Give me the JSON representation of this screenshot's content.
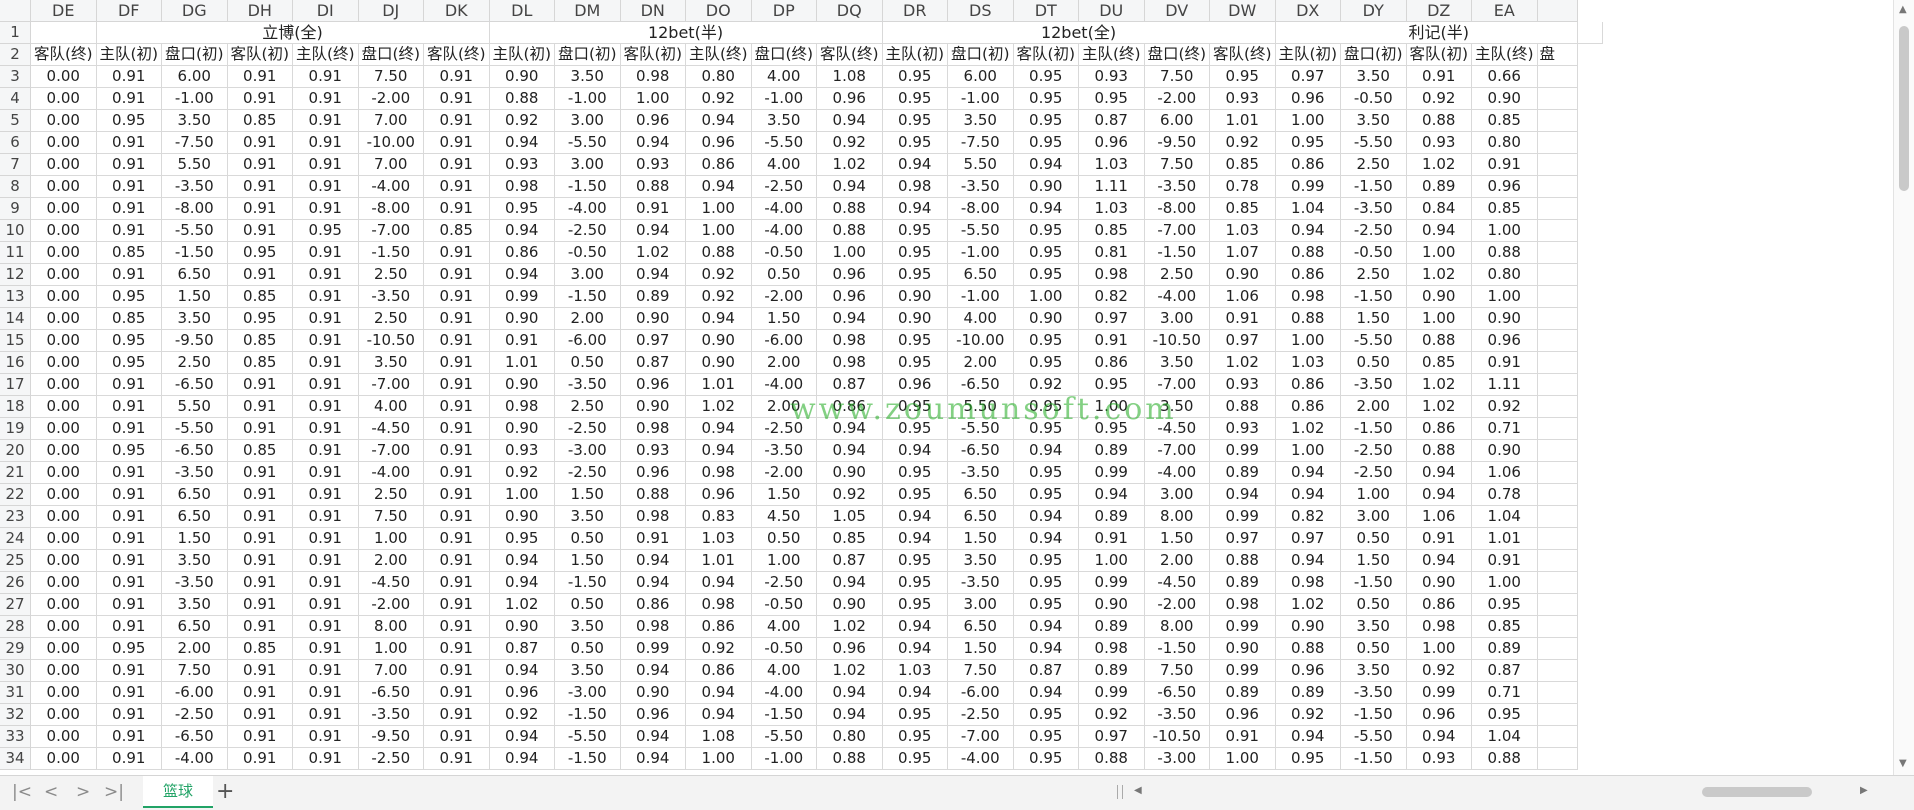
{
  "columns": [
    "DE",
    "DF",
    "DG",
    "DH",
    "DI",
    "DJ",
    "DK",
    "DL",
    "DM",
    "DN",
    "DO",
    "DP",
    "DQ",
    "DR",
    "DS",
    "DT",
    "DU",
    "DV",
    "DW",
    "DX",
    "DY",
    "DZ",
    "EA"
  ],
  "merged_headers": [
    {
      "text": "立博(全)",
      "start": 1,
      "span": 6
    },
    {
      "text": "12bet(半)",
      "start": 7,
      "span": 6
    },
    {
      "text": "12bet(全)",
      "start": 13,
      "span": 6
    },
    {
      "text": "利记(半)",
      "start": 19,
      "span": 5
    }
  ],
  "row2": [
    "客队(终)",
    "主队(初)",
    "盘口(初)",
    "客队(初)",
    "主队(终)",
    "盘口(终)",
    "客队(终)",
    "主队(初)",
    "盘口(初)",
    "客队(初)",
    "主队(终)",
    "盘口(终)",
    "客队(终)",
    "主队(初)",
    "盘口(初)",
    "客队(初)",
    "主队(终)",
    "盘口(终)",
    "客队(终)",
    "主队(初)",
    "盘口(初)",
    "客队(初)",
    "主队(终)"
  ],
  "row2_partial": "盘",
  "rows": [
    {
      "n": "1"
    },
    {
      "n": "2"
    },
    {
      "n": "3",
      "v": [
        "0.00",
        "0.91",
        "6.00",
        "0.91",
        "0.91",
        "7.50",
        "0.91",
        "0.90",
        "3.50",
        "0.98",
        "0.80",
        "4.00",
        "1.08",
        "0.95",
        "6.00",
        "0.95",
        "0.93",
        "7.50",
        "0.95",
        "0.97",
        "3.50",
        "0.91",
        "0.66"
      ]
    },
    {
      "n": "4",
      "v": [
        "0.00",
        "0.91",
        "-1.00",
        "0.91",
        "0.91",
        "-2.00",
        "0.91",
        "0.88",
        "-1.00",
        "1.00",
        "0.92",
        "-1.00",
        "0.96",
        "0.95",
        "-1.00",
        "0.95",
        "0.95",
        "-2.00",
        "0.93",
        "0.96",
        "-0.50",
        "0.92",
        "0.90"
      ]
    },
    {
      "n": "5",
      "v": [
        "0.00",
        "0.95",
        "3.50",
        "0.85",
        "0.91",
        "7.00",
        "0.91",
        "0.92",
        "3.00",
        "0.96",
        "0.94",
        "3.50",
        "0.94",
        "0.95",
        "3.50",
        "0.95",
        "0.87",
        "6.00",
        "1.01",
        "1.00",
        "3.50",
        "0.88",
        "0.85"
      ]
    },
    {
      "n": "6",
      "v": [
        "0.00",
        "0.91",
        "-7.50",
        "0.91",
        "0.91",
        "-10.00",
        "0.91",
        "0.94",
        "-5.50",
        "0.94",
        "0.96",
        "-5.50",
        "0.92",
        "0.95",
        "-7.50",
        "0.95",
        "0.96",
        "-9.50",
        "0.92",
        "0.95",
        "-5.50",
        "0.93",
        "0.80"
      ]
    },
    {
      "n": "7",
      "v": [
        "0.00",
        "0.91",
        "5.50",
        "0.91",
        "0.91",
        "7.00",
        "0.91",
        "0.93",
        "3.00",
        "0.93",
        "0.86",
        "4.00",
        "1.02",
        "0.94",
        "5.50",
        "0.94",
        "1.03",
        "7.50",
        "0.85",
        "0.86",
        "2.50",
        "1.02",
        "0.91"
      ]
    },
    {
      "n": "8",
      "v": [
        "0.00",
        "0.91",
        "-3.50",
        "0.91",
        "0.91",
        "-4.00",
        "0.91",
        "0.98",
        "-1.50",
        "0.88",
        "0.94",
        "-2.50",
        "0.94",
        "0.98",
        "-3.50",
        "0.90",
        "1.11",
        "-3.50",
        "0.78",
        "0.99",
        "-1.50",
        "0.89",
        "0.96"
      ]
    },
    {
      "n": "9",
      "v": [
        "0.00",
        "0.91",
        "-8.00",
        "0.91",
        "0.91",
        "-8.00",
        "0.91",
        "0.95",
        "-4.00",
        "0.91",
        "1.00",
        "-4.00",
        "0.88",
        "0.94",
        "-8.00",
        "0.94",
        "1.03",
        "-8.00",
        "0.85",
        "1.04",
        "-3.50",
        "0.84",
        "0.85"
      ]
    },
    {
      "n": "10",
      "v": [
        "0.00",
        "0.91",
        "-5.50",
        "0.91",
        "0.95",
        "-7.00",
        "0.85",
        "0.94",
        "-2.50",
        "0.94",
        "1.00",
        "-4.00",
        "0.88",
        "0.95",
        "-5.50",
        "0.95",
        "0.85",
        "-7.00",
        "1.03",
        "0.94",
        "-2.50",
        "0.94",
        "1.00"
      ]
    },
    {
      "n": "11",
      "v": [
        "0.00",
        "0.85",
        "-1.50",
        "0.95",
        "0.91",
        "-1.50",
        "0.91",
        "0.86",
        "-0.50",
        "1.02",
        "0.88",
        "-0.50",
        "1.00",
        "0.95",
        "-1.00",
        "0.95",
        "0.81",
        "-1.50",
        "1.07",
        "0.88",
        "-0.50",
        "1.00",
        "0.88"
      ]
    },
    {
      "n": "12",
      "v": [
        "0.00",
        "0.91",
        "6.50",
        "0.91",
        "0.91",
        "2.50",
        "0.91",
        "0.94",
        "3.00",
        "0.94",
        "0.92",
        "0.50",
        "0.96",
        "0.95",
        "6.50",
        "0.95",
        "0.98",
        "2.50",
        "0.90",
        "0.86",
        "2.50",
        "1.02",
        "0.80"
      ]
    },
    {
      "n": "13",
      "v": [
        "0.00",
        "0.95",
        "1.50",
        "0.85",
        "0.91",
        "-3.50",
        "0.91",
        "0.99",
        "-1.50",
        "0.89",
        "0.92",
        "-2.00",
        "0.96",
        "0.90",
        "-1.00",
        "1.00",
        "0.82",
        "-4.00",
        "1.06",
        "0.98",
        "-1.50",
        "0.90",
        "1.00"
      ]
    },
    {
      "n": "14",
      "v": [
        "0.00",
        "0.85",
        "3.50",
        "0.95",
        "0.91",
        "2.50",
        "0.91",
        "0.90",
        "2.00",
        "0.90",
        "0.94",
        "1.50",
        "0.94",
        "0.90",
        "4.00",
        "0.90",
        "0.97",
        "3.00",
        "0.91",
        "0.88",
        "1.50",
        "1.00",
        "0.90"
      ]
    },
    {
      "n": "15",
      "v": [
        "0.00",
        "0.95",
        "-9.50",
        "0.85",
        "0.91",
        "-10.50",
        "0.91",
        "0.91",
        "-6.00",
        "0.97",
        "0.90",
        "-6.00",
        "0.98",
        "0.95",
        "-10.00",
        "0.95",
        "0.91",
        "-10.50",
        "0.97",
        "1.00",
        "-5.50",
        "0.88",
        "0.96"
      ]
    },
    {
      "n": "16",
      "v": [
        "0.00",
        "0.95",
        "2.50",
        "0.85",
        "0.91",
        "3.50",
        "0.91",
        "1.01",
        "0.50",
        "0.87",
        "0.90",
        "2.00",
        "0.98",
        "0.95",
        "2.00",
        "0.95",
        "0.86",
        "3.50",
        "1.02",
        "1.03",
        "0.50",
        "0.85",
        "0.91"
      ]
    },
    {
      "n": "17",
      "v": [
        "0.00",
        "0.91",
        "-6.50",
        "0.91",
        "0.91",
        "-7.00",
        "0.91",
        "0.90",
        "-3.50",
        "0.96",
        "1.01",
        "-4.00",
        "0.87",
        "0.96",
        "-6.50",
        "0.92",
        "0.95",
        "-7.00",
        "0.93",
        "0.86",
        "-3.50",
        "1.02",
        "1.11"
      ]
    },
    {
      "n": "18",
      "v": [
        "0.00",
        "0.91",
        "5.50",
        "0.91",
        "0.91",
        "4.00",
        "0.91",
        "0.98",
        "2.50",
        "0.90",
        "1.02",
        "2.00",
        "0.86",
        "0.95",
        "5.50",
        "0.95",
        "1.00",
        "3.50",
        "0.88",
        "0.86",
        "2.00",
        "1.02",
        "0.92"
      ]
    },
    {
      "n": "19",
      "v": [
        "0.00",
        "0.91",
        "-5.50",
        "0.91",
        "0.91",
        "-4.50",
        "0.91",
        "0.90",
        "-2.50",
        "0.98",
        "0.94",
        "-2.50",
        "0.94",
        "0.95",
        "-5.50",
        "0.95",
        "0.95",
        "-4.50",
        "0.93",
        "1.02",
        "-1.50",
        "0.86",
        "0.71"
      ]
    },
    {
      "n": "20",
      "v": [
        "0.00",
        "0.95",
        "-6.50",
        "0.85",
        "0.91",
        "-7.00",
        "0.91",
        "0.93",
        "-3.00",
        "0.93",
        "0.94",
        "-3.50",
        "0.94",
        "0.94",
        "-6.50",
        "0.94",
        "0.89",
        "-7.00",
        "0.99",
        "1.00",
        "-2.50",
        "0.88",
        "0.90"
      ]
    },
    {
      "n": "21",
      "v": [
        "0.00",
        "0.91",
        "-3.50",
        "0.91",
        "0.91",
        "-4.00",
        "0.91",
        "0.92",
        "-2.50",
        "0.96",
        "0.98",
        "-2.00",
        "0.90",
        "0.95",
        "-3.50",
        "0.95",
        "0.99",
        "-4.00",
        "0.89",
        "0.94",
        "-2.50",
        "0.94",
        "1.06"
      ]
    },
    {
      "n": "22",
      "v": [
        "0.00",
        "0.91",
        "6.50",
        "0.91",
        "0.91",
        "2.50",
        "0.91",
        "1.00",
        "1.50",
        "0.88",
        "0.96",
        "1.50",
        "0.92",
        "0.95",
        "6.50",
        "0.95",
        "0.94",
        "3.00",
        "0.94",
        "0.94",
        "1.00",
        "0.94",
        "0.78"
      ]
    },
    {
      "n": "23",
      "v": [
        "0.00",
        "0.91",
        "6.50",
        "0.91",
        "0.91",
        "7.50",
        "0.91",
        "0.90",
        "3.50",
        "0.98",
        "0.83",
        "4.50",
        "1.05",
        "0.94",
        "6.50",
        "0.94",
        "0.89",
        "8.00",
        "0.99",
        "0.82",
        "3.00",
        "1.06",
        "1.04"
      ]
    },
    {
      "n": "24",
      "v": [
        "0.00",
        "0.91",
        "1.50",
        "0.91",
        "0.91",
        "1.00",
        "0.91",
        "0.95",
        "0.50",
        "0.91",
        "1.03",
        "0.50",
        "0.85",
        "0.94",
        "1.50",
        "0.94",
        "0.91",
        "1.50",
        "0.97",
        "0.97",
        "0.50",
        "0.91",
        "1.01"
      ]
    },
    {
      "n": "25",
      "v": [
        "0.00",
        "0.91",
        "3.50",
        "0.91",
        "0.91",
        "2.00",
        "0.91",
        "0.94",
        "1.50",
        "0.94",
        "1.01",
        "1.00",
        "0.87",
        "0.95",
        "3.50",
        "0.95",
        "1.00",
        "2.00",
        "0.88",
        "0.94",
        "1.50",
        "0.94",
        "0.91"
      ]
    },
    {
      "n": "26",
      "v": [
        "0.00",
        "0.91",
        "-3.50",
        "0.91",
        "0.91",
        "-4.50",
        "0.91",
        "0.94",
        "-1.50",
        "0.94",
        "0.94",
        "-2.50",
        "0.94",
        "0.95",
        "-3.50",
        "0.95",
        "0.99",
        "-4.50",
        "0.89",
        "0.98",
        "-1.50",
        "0.90",
        "1.00"
      ]
    },
    {
      "n": "27",
      "v": [
        "0.00",
        "0.91",
        "3.50",
        "0.91",
        "0.91",
        "-2.00",
        "0.91",
        "1.02",
        "0.50",
        "0.86",
        "0.98",
        "-0.50",
        "0.90",
        "0.95",
        "3.00",
        "0.95",
        "0.90",
        "-2.00",
        "0.98",
        "1.02",
        "0.50",
        "0.86",
        "0.95"
      ]
    },
    {
      "n": "28",
      "v": [
        "0.00",
        "0.91",
        "6.50",
        "0.91",
        "0.91",
        "8.00",
        "0.91",
        "0.90",
        "3.50",
        "0.98",
        "0.86",
        "4.00",
        "1.02",
        "0.94",
        "6.50",
        "0.94",
        "0.89",
        "8.00",
        "0.99",
        "0.90",
        "3.50",
        "0.98",
        "0.85"
      ]
    },
    {
      "n": "29",
      "v": [
        "0.00",
        "0.95",
        "2.00",
        "0.85",
        "0.91",
        "1.00",
        "0.91",
        "0.87",
        "0.50",
        "0.99",
        "0.92",
        "-0.50",
        "0.96",
        "0.94",
        "1.50",
        "0.94",
        "0.98",
        "-1.50",
        "0.90",
        "0.88",
        "0.50",
        "1.00",
        "0.89"
      ]
    },
    {
      "n": "30",
      "v": [
        "0.00",
        "0.91",
        "7.50",
        "0.91",
        "0.91",
        "7.00",
        "0.91",
        "0.94",
        "3.50",
        "0.94",
        "0.86",
        "4.00",
        "1.02",
        "1.03",
        "7.50",
        "0.87",
        "0.89",
        "7.50",
        "0.99",
        "0.96",
        "3.50",
        "0.92",
        "0.87"
      ]
    },
    {
      "n": "31",
      "v": [
        "0.00",
        "0.91",
        "-6.00",
        "0.91",
        "0.91",
        "-6.50",
        "0.91",
        "0.96",
        "-3.00",
        "0.90",
        "0.94",
        "-4.00",
        "0.94",
        "0.94",
        "-6.00",
        "0.94",
        "0.99",
        "-6.50",
        "0.89",
        "0.89",
        "-3.50",
        "0.99",
        "0.71"
      ]
    },
    {
      "n": "32",
      "v": [
        "0.00",
        "0.91",
        "-2.50",
        "0.91",
        "0.91",
        "-3.50",
        "0.91",
        "0.92",
        "-1.50",
        "0.96",
        "0.94",
        "-1.50",
        "0.94",
        "0.95",
        "-2.50",
        "0.95",
        "0.92",
        "-3.50",
        "0.96",
        "0.92",
        "-1.50",
        "0.96",
        "0.95"
      ]
    },
    {
      "n": "33",
      "v": [
        "0.00",
        "0.91",
        "-6.50",
        "0.91",
        "0.91",
        "-9.50",
        "0.91",
        "0.94",
        "-5.50",
        "0.94",
        "1.08",
        "-5.50",
        "0.80",
        "0.95",
        "-7.00",
        "0.95",
        "0.97",
        "-10.50",
        "0.91",
        "0.94",
        "-5.50",
        "0.94",
        "1.04"
      ]
    },
    {
      "n": "34",
      "v": [
        "0.00",
        "0.91",
        "-4.00",
        "0.91",
        "0.91",
        "-2.50",
        "0.91",
        "0.94",
        "-1.50",
        "0.94",
        "1.00",
        "-1.00",
        "0.88",
        "0.95",
        "-4.00",
        "0.95",
        "0.88",
        "-3.00",
        "1.00",
        "0.95",
        "-1.50",
        "0.93",
        "0.88"
      ]
    }
  ],
  "sheet_tab": "篮球",
  "watermark": "www.zoumunsoft.com",
  "colors": {
    "accent": "#21a366",
    "grid": "#d9d9d9",
    "header_bg": "#f5f6f7"
  }
}
